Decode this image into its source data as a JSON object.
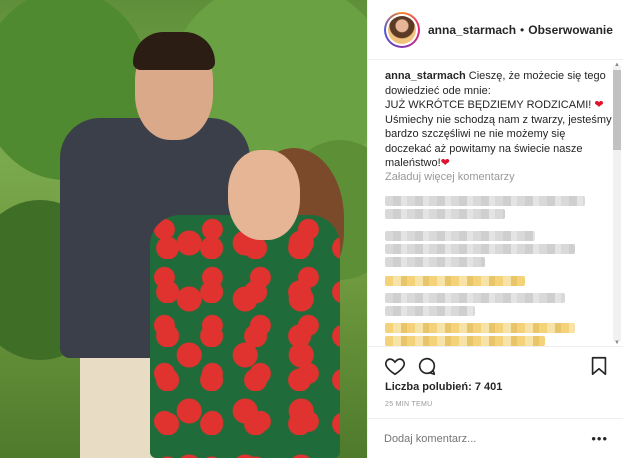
{
  "post": {
    "username": "anna_starmach",
    "follow_label": "Obserwowanie",
    "separator": "•"
  },
  "caption": {
    "username": "anna_starmach",
    "line1": "Cieszę, że możecie się tego dowiedzieć ode mnie:",
    "line2": "JUŻ WKRÓTCE BĘDZIEMY RODZICAMI!",
    "line3": "Uśmiechy nie schodzą nam z twarzy, jesteśmy bardzo szczęśliwi ne nie możemy się doczekać aż powitamy na świecie nasze maleństwo!",
    "heart": "❤"
  },
  "comments": {
    "load_more": "Załaduj więcej komentarzy"
  },
  "actions": {
    "icons": [
      "heart-icon",
      "comment-icon",
      "bookmark-icon"
    ]
  },
  "likes": {
    "label": "Liczba polubień: 7 401"
  },
  "timestamp": "25 MIN TEMU",
  "add_comment": {
    "placeholder": "Dodaj komentarz...",
    "more": "•••"
  },
  "colors": {
    "heart": "#e0102c",
    "border": "#efefef",
    "muted": "#999999"
  }
}
